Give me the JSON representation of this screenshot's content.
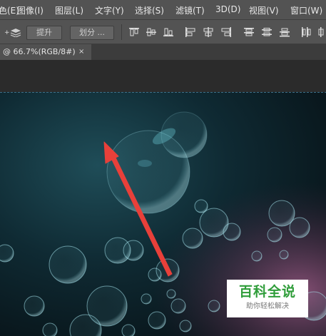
{
  "menu": {
    "items": [
      "色(E)",
      "图像(I)",
      "图层(L)",
      "文字(Y)",
      "选择(S)",
      "滤镜(T)",
      "3D(D)",
      "视图(V)",
      "窗口(W)"
    ]
  },
  "options": {
    "lift_label": "提升",
    "divide_label": "划分 ..."
  },
  "document": {
    "tab_title": "@ 66.7%(RGB/8#)",
    "close_glyph": "×"
  },
  "watermark": {
    "title": "百科全说",
    "subtitle": "助你轻松解决"
  },
  "colors": {
    "arrow": "#e8403a",
    "watermark_green": "#2f9d3a",
    "panel": "#535353"
  }
}
